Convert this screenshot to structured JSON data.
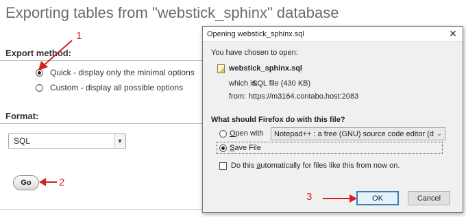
{
  "page": {
    "title": "Exporting tables from \"webstick_sphinx\" database",
    "export_method_label": "Export method:",
    "options": [
      {
        "label": "Quick - display only the minimal options",
        "checked": true
      },
      {
        "label": "Custom - display all possible options",
        "checked": false
      }
    ],
    "format_label": "Format:",
    "format_value": "SQL",
    "go_label": "Go"
  },
  "annotations": {
    "n1": "1",
    "n2": "2",
    "n3": "3",
    "color": "#d42020"
  },
  "dialog": {
    "title": "Opening webstick_sphinx.sql",
    "chosen_text": "You have chosen to open:",
    "file_name": "webstick_sphinx.sql",
    "which_is_label": "which is:",
    "which_is_value": "SQL file (430 KB)",
    "from_label": "from:",
    "from_value": "https://m3164.contabo.host:2083",
    "question": "What should Firefox do with this file?",
    "open_with_label_pre": "",
    "open_with_accel": "O",
    "open_with_label_post": "pen with",
    "open_with_app": "Notepad++ : a free (GNU) source code editor (d...",
    "save_file_accel": "S",
    "save_file_post": "ave File",
    "auto_pre": "Do this ",
    "auto_accel": "a",
    "auto_post": "utomatically for files like this from now on.",
    "ok_label": "OK",
    "cancel_label": "Cancel"
  }
}
